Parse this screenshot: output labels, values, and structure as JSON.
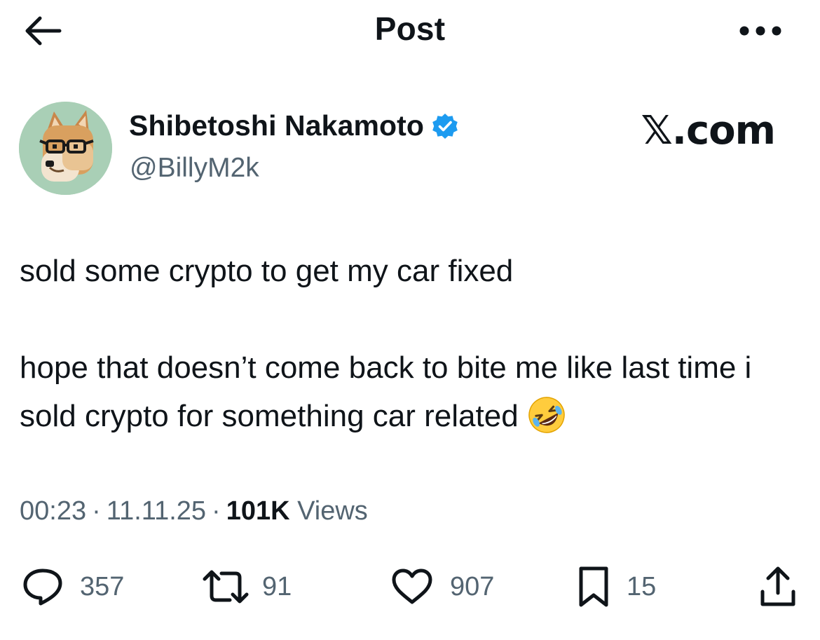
{
  "header": {
    "title": "Post",
    "back_icon": "arrow-left-icon",
    "more_icon": "more-dots-icon"
  },
  "author": {
    "display_name": "Shibetoshi Nakamoto",
    "handle": "@BillyM2k",
    "verified_color": "#1d9bf0",
    "avatar": "shiba-with-glasses-avatar"
  },
  "brand": "𝕏.com",
  "post": {
    "paragraphs": [
      "sold some crypto to get my car fixed",
      "hope that doesn’t come back to bite me like last time i sold crypto for something car related"
    ],
    "emoji": "rolling-on-floor-laughing-emoji"
  },
  "meta": {
    "time": "00:23",
    "date": "11.11.25",
    "views_count": "101K",
    "views_label": "Views"
  },
  "actions": {
    "replies": "357",
    "reposts": "91",
    "likes": "907",
    "bookmarks": "15"
  },
  "colors": {
    "text": "#0f1419",
    "secondary": "#536471",
    "accent": "#1d9bf0"
  }
}
